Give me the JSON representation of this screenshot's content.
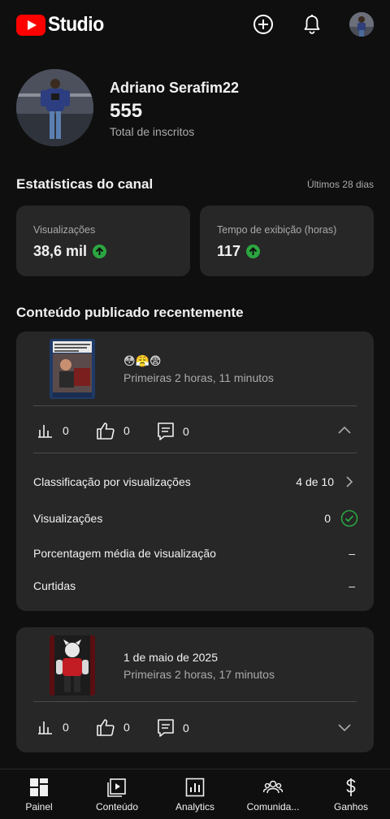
{
  "header": {
    "logo_text": "Studio",
    "icons": [
      "add-icon",
      "bell-icon",
      "account-avatar"
    ]
  },
  "channel": {
    "name": "Adriano Serafim22",
    "subscribers": "555",
    "subscribers_label": "Total de inscritos"
  },
  "stats": {
    "title": "Estatísticas do canal",
    "period": "Últimos 28 dias",
    "cards": [
      {
        "label": "Visualizações",
        "value": "38,6 mil",
        "trend": "up"
      },
      {
        "label": "Tempo de exibição (horas)",
        "value": "117",
        "trend": "up"
      }
    ]
  },
  "recent": {
    "title": "Conteúdo publicado recentemente",
    "videos": [
      {
        "title": "😳😤😨",
        "subtitle": "Primeiras 2 horas, 11 minutos",
        "views": "0",
        "likes": "0",
        "comments": "0",
        "expanded": true,
        "details": [
          {
            "label": "Classificação por visualizações",
            "value": "4 de 10",
            "icon": "chevron-right-icon"
          },
          {
            "label": "Visualizações",
            "value": "0",
            "icon": "check-circle-icon"
          },
          {
            "label": "Porcentagem média de visualização",
            "value": "–"
          },
          {
            "label": "Curtidas",
            "value": "–"
          }
        ]
      },
      {
        "title": "1 de maio de 2025",
        "subtitle": "Primeiras 2 horas, 17 minutos",
        "views": "0",
        "likes": "0",
        "comments": "0",
        "expanded": false
      }
    ]
  },
  "nav": {
    "items": [
      {
        "label": "Painel",
        "icon": "dashboard-icon"
      },
      {
        "label": "Conteúdo",
        "icon": "content-icon"
      },
      {
        "label": "Analytics",
        "icon": "analytics-icon"
      },
      {
        "label": "Comunida...",
        "icon": "community-icon"
      },
      {
        "label": "Ganhos",
        "icon": "earn-icon"
      }
    ]
  },
  "colors": {
    "background": "#0f0f0f",
    "card": "#272727",
    "accent_red": "#ff0000",
    "positive_green": "#2ba640"
  }
}
